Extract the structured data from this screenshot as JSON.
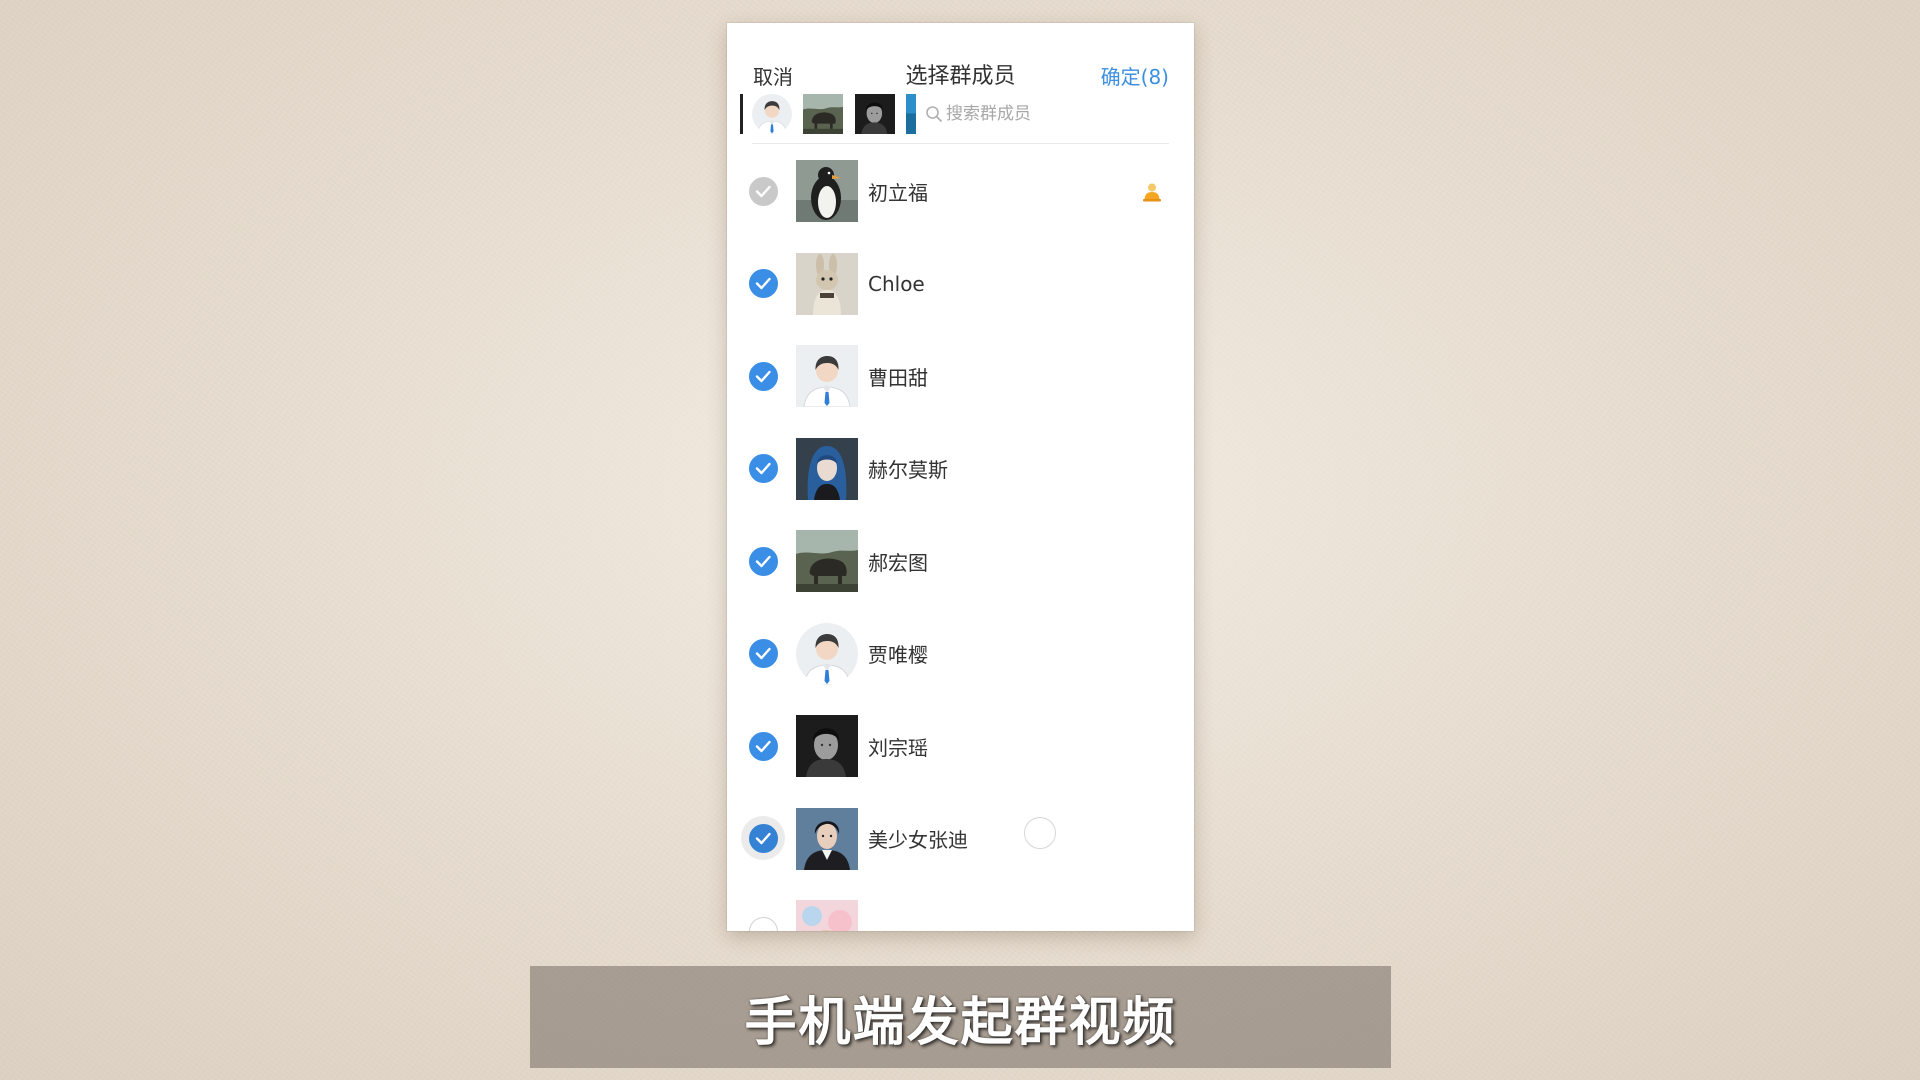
{
  "header": {
    "cancel_label": "取消",
    "title": "选择群成员",
    "confirm_label": "确定(8)"
  },
  "selected_strip": {
    "avatars": [
      "default-person-avatar",
      "landscape-avatar",
      "dark-portrait-avatar",
      "blue-partial-avatar"
    ],
    "search_placeholder": "搜索群成员",
    "search_icon": "search-icon"
  },
  "members": [
    {
      "name": "初立福",
      "checked": true,
      "disabled": true,
      "avatar": "penguin-avatar",
      "owner": true
    },
    {
      "name": "Chloe",
      "checked": true,
      "disabled": false,
      "avatar": "plush-rabbit-avatar"
    },
    {
      "name": "曹田甜",
      "checked": true,
      "disabled": false,
      "avatar": "default-person-avatar"
    },
    {
      "name": "赫尔莫斯",
      "checked": true,
      "disabled": false,
      "avatar": "blue-hair-portrait-avatar"
    },
    {
      "name": "郝宏图",
      "checked": true,
      "disabled": false,
      "avatar": "landscape-avatar"
    },
    {
      "name": "贾唯樱",
      "checked": true,
      "disabled": false,
      "avatar": "default-person-avatar"
    },
    {
      "name": "刘宗瑶",
      "checked": true,
      "disabled": false,
      "avatar": "dark-portrait-avatar"
    },
    {
      "name": "美少女张迪",
      "checked": true,
      "disabled": false,
      "avatar": "young-man-portrait-avatar",
      "pressed": true
    },
    {
      "checked": false,
      "disabled": false,
      "avatar": "pastel-avatar"
    }
  ],
  "owner_icon": "group-owner-icon",
  "caption": "手机端发起群视频",
  "colors": {
    "accent": "#3a8ee6",
    "confirm": "#3d8fe0",
    "disabled_check": "#c9c9c9",
    "owner_badge": "#f5a623"
  }
}
